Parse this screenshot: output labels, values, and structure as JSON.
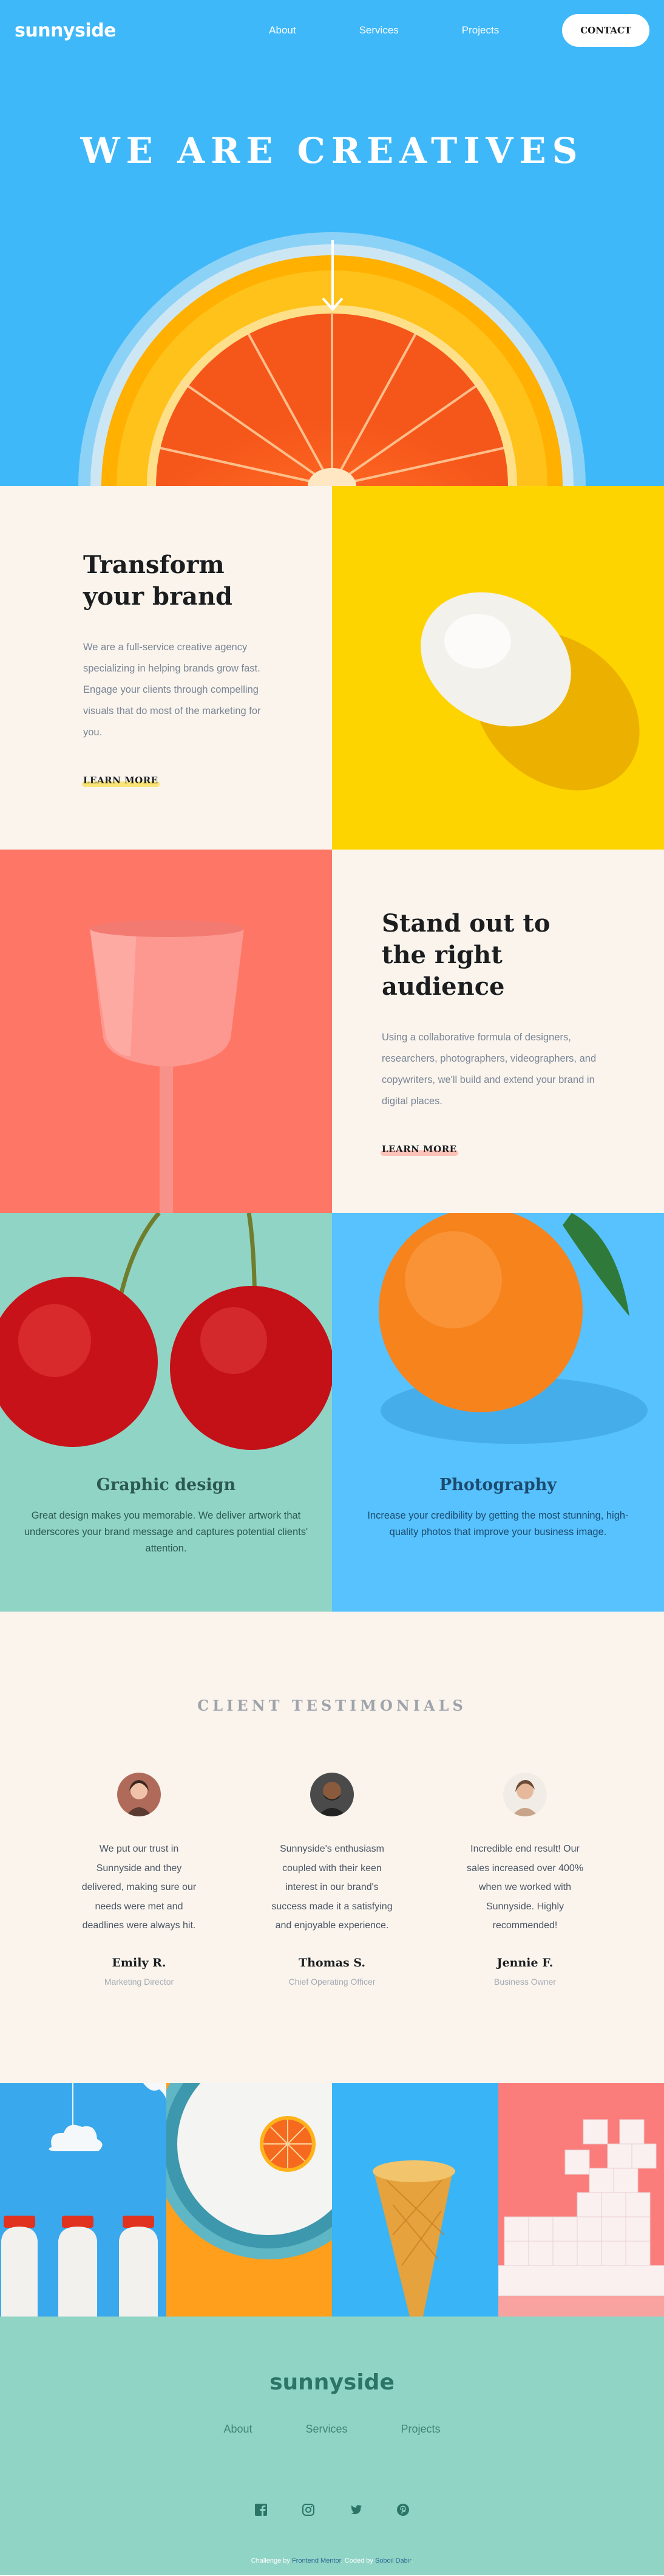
{
  "nav": {
    "logo": "sunnyside",
    "links": [
      "About",
      "Services",
      "Projects"
    ],
    "contact_label": "CONTACT"
  },
  "hero": {
    "title": "WE ARE CREATIVES"
  },
  "transform": {
    "title": "Transform your brand",
    "text": "We are a full-service creative agency specializing in helping brands grow fast. Engage your clients through compelling visuals that do most of the marketing for you.",
    "link": "LEARN MORE",
    "underline_color": "#fad400"
  },
  "standout": {
    "title": "Stand out to the right audience",
    "text": "Using a collaborative formula of designers, researchers, photographers, videographers, and copywriters, we'll build and extend your brand in digital places.",
    "link": "LEARN MORE",
    "underline_color": "#fe7766"
  },
  "services": [
    {
      "title": "Graphic design",
      "text": "Great design makes you memorable. We deliver artwork that underscores your brand message and captures potential clients' attention.",
      "bg": "#90d4c5",
      "color": "#2c5a50"
    },
    {
      "title": "Photography",
      "text": "Increase your credibility by getting the most stunning, high-quality photos that improve your business image.",
      "bg": "#57c2fd",
      "color": "#1c4b70"
    }
  ],
  "testimonials": {
    "heading": "CLIENT TESTIMONIALS",
    "items": [
      {
        "quote": "We put our trust in Sunnyside and they delivered, making sure our needs were met and deadlines were always hit.",
        "name": "Emily R.",
        "role": "Marketing Director"
      },
      {
        "quote": "Sunnyside's enthusiasm coupled with their keen interest in our brand's success made it a satisfying and enjoyable experience.",
        "name": "Thomas S.",
        "role": "Chief Operating Officer"
      },
      {
        "quote": "Incredible end result! Our sales increased over 400% when we worked with Sunnyside. Highly recommended!",
        "name": "Jennie F.",
        "role": "Business Owner"
      }
    ]
  },
  "footer": {
    "logo": "sunnyside",
    "links": [
      "About",
      "Services",
      "Projects"
    ],
    "social_icons": [
      "facebook-icon",
      "instagram-icon",
      "twitter-icon",
      "pinterest-icon"
    ],
    "attribution": {
      "prefix": "Challenge by",
      "challenge_link": "Frontend Mentor",
      "middle": "Coded by",
      "author_link": "Soboil Dabir"
    }
  }
}
